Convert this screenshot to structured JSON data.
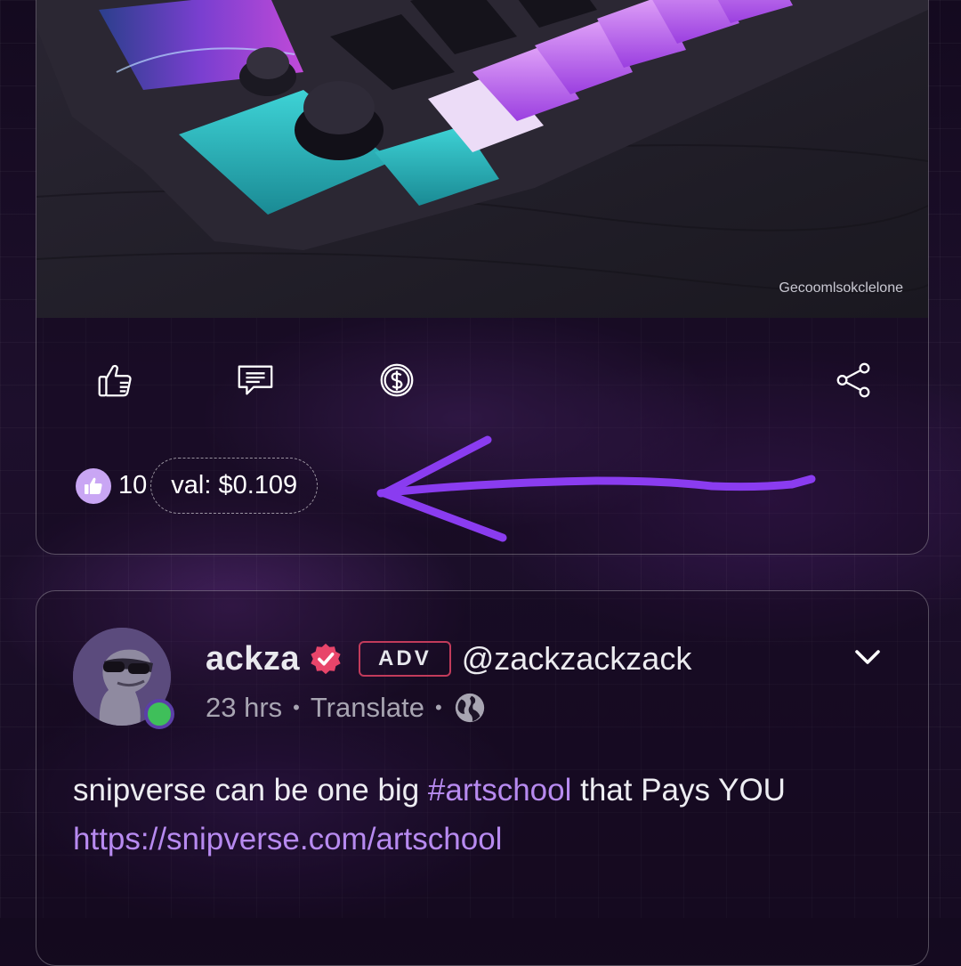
{
  "post1": {
    "watermark": "Gecoomlsokclelone",
    "actions": [
      {
        "name": "like",
        "icon": "thumbs-up-icon"
      },
      {
        "name": "comment",
        "icon": "comment-icon"
      },
      {
        "name": "tip",
        "icon": "dollar-coin-icon"
      },
      {
        "name": "share",
        "icon": "share-icon"
      }
    ],
    "like_count": "10",
    "value_label": "val: $0.109"
  },
  "post2": {
    "author_name": "ackza",
    "badge": "ADV",
    "handle": "@zackzackzack",
    "time": "23 hrs",
    "translate_label": "Translate",
    "text_prefix": "snipverse can be one big ",
    "hashtag": "#artschool",
    "text_middle": " that Pays YOU ",
    "link": "https://snipverse.com/artschool"
  },
  "colors": {
    "accent_purple": "#b78af0",
    "annotation_arrow": "#8a3cf0",
    "adv_border": "#c23b5b",
    "verified": "#e8456a",
    "online": "#3fbf5a",
    "like_badge": "#c9a6f4"
  }
}
